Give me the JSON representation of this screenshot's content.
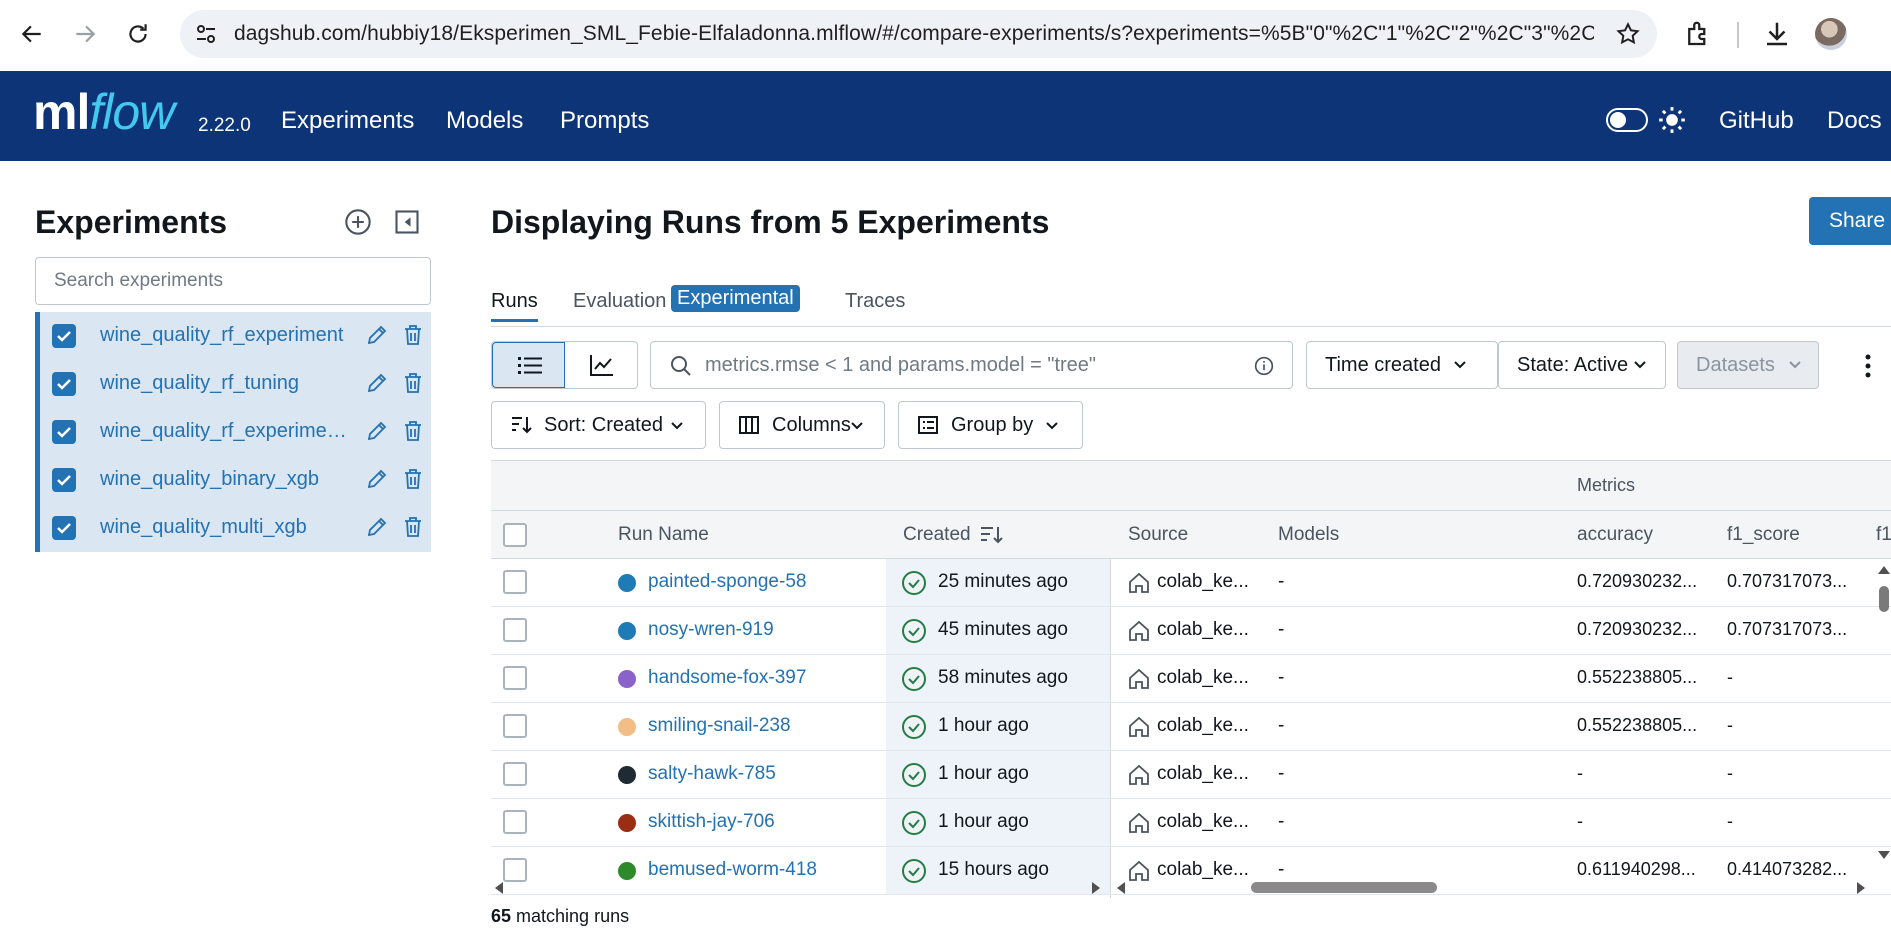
{
  "browser": {
    "url": "dagshub.com/hubbiy18/Eksperimen_SML_Febie-Elfaladonna.mlflow/#/compare-experiments/s?experiments=%5B\"0\"%2C\"1\"%2C\"2\"%2C\"3\"%2C\"..."
  },
  "header": {
    "logo_ml": "ml",
    "logo_flow": "flow",
    "version": "2.22.0",
    "nav": [
      "Experiments",
      "Models",
      "Prompts"
    ],
    "github": "GitHub",
    "docs": "Docs"
  },
  "sidebar": {
    "title": "Experiments",
    "search_placeholder": "Search experiments",
    "experiments": [
      {
        "name": "wine_quality_rf_experiment"
      },
      {
        "name": "wine_quality_rf_tuning"
      },
      {
        "name": "wine_quality_rf_experiment_..."
      },
      {
        "name": "wine_quality_binary_xgb"
      },
      {
        "name": "wine_quality_multi_xgb"
      }
    ]
  },
  "main": {
    "title": "Displaying Runs from 5 Experiments",
    "share": "Share",
    "tabs": {
      "runs": "Runs",
      "evaluation": "Evaluation",
      "experimental": "Experimental",
      "traces": "Traces"
    },
    "search_placeholder": "metrics.rmse < 1 and params.model = \"tree\"",
    "time_created": "Time created",
    "state": "State: Active",
    "datasets": "Datasets",
    "sort": "Sort: Created",
    "columns": "Columns",
    "group_by": "Group by"
  },
  "table": {
    "group_metrics": "Metrics",
    "headers": {
      "run_name": "Run Name",
      "created": "Created",
      "source": "Source",
      "models": "Models",
      "accuracy": "accuracy",
      "f1_score": "f1_score",
      "f1_cut": "f1"
    },
    "rows": [
      {
        "name": "painted-sponge-58",
        "color": "#1f7bb5",
        "created": "25 minutes ago",
        "source": "colab_ke...",
        "models": "-",
        "accuracy": "0.720930232...",
        "f1": "0.707317073..."
      },
      {
        "name": "nosy-wren-919",
        "color": "#1f7bb5",
        "created": "45 minutes ago",
        "source": "colab_ke...",
        "models": "-",
        "accuracy": "0.720930232...",
        "f1": "0.707317073..."
      },
      {
        "name": "handsome-fox-397",
        "color": "#8b62c9",
        "created": "58 minutes ago",
        "source": "colab_ke...",
        "models": "-",
        "accuracy": "0.552238805...",
        "f1": "-"
      },
      {
        "name": "smiling-snail-238",
        "color": "#f2be86",
        "created": "1 hour ago",
        "source": "colab_ke...",
        "models": "-",
        "accuracy": "0.552238805...",
        "f1": "-"
      },
      {
        "name": "salty-hawk-785",
        "color": "#1f2a33",
        "created": "1 hour ago",
        "source": "colab_ke...",
        "models": "-",
        "accuracy": "-",
        "f1": "-"
      },
      {
        "name": "skittish-jay-706",
        "color": "#9a2e12",
        "created": "1 hour ago",
        "source": "colab_ke...",
        "models": "-",
        "accuracy": "-",
        "f1": "-"
      },
      {
        "name": "bemused-worm-418",
        "color": "#2d8a2a",
        "created": "15 hours ago",
        "source": "colab_ke...",
        "models": "-",
        "accuracy": "0.611940298...",
        "f1": "0.414073282..."
      }
    ],
    "matching_count": "65",
    "matching_label": " matching runs"
  }
}
